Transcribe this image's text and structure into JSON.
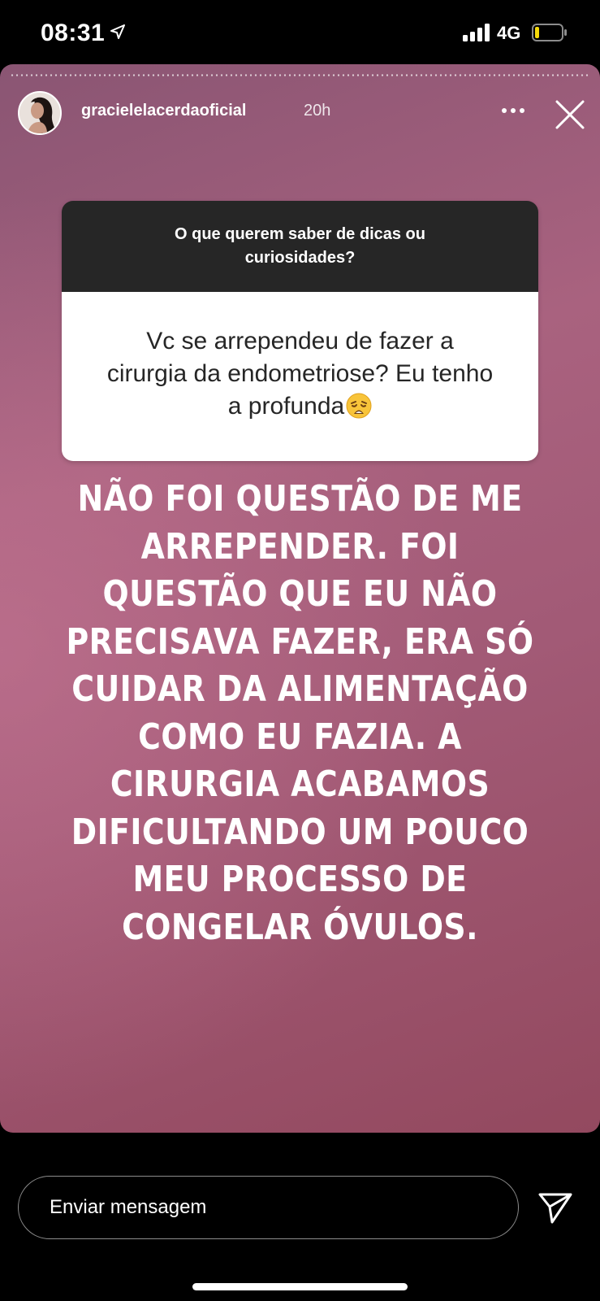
{
  "status_bar": {
    "time": "08:31",
    "network": "4G"
  },
  "story": {
    "username": "gracielelacerdaoficial",
    "time_ago": "20h",
    "question_sticker": {
      "prompt": "O que querem saber de dicas ou curiosidades?",
      "answer": "Vc se arrependeu de fazer a cirurgia da endometriose? Eu tenho a profunda"
    },
    "caption": "NÃO FOI QUESTÃO DE ME ARREPENDER. FOI QUESTÃO QUE EU NÃO PRECISAVA FAZER, ERA SÓ CUIDAR DA ALIMENTAÇÃO COMO EU FAZIA. A CIRURGIA ACABAMOS DIFICULTANDO UM POUCO MEU PROCESSO DE CONGELAR ÓVULOS."
  },
  "reply_bar": {
    "placeholder": "Enviar mensagem"
  },
  "icons": {
    "location": "location-arrow-icon",
    "signal": "signal-bars-icon",
    "battery": "battery-icon",
    "more": "more-dots-icon",
    "close": "close-icon",
    "send": "send-paper-plane-icon",
    "emoji": "weary-face-emoji"
  },
  "colors": {
    "battery_level": "#f5d90a",
    "story_gradient_top": "#8a5573",
    "story_gradient_bottom": "#93495f",
    "sticker_header": "#262626"
  }
}
